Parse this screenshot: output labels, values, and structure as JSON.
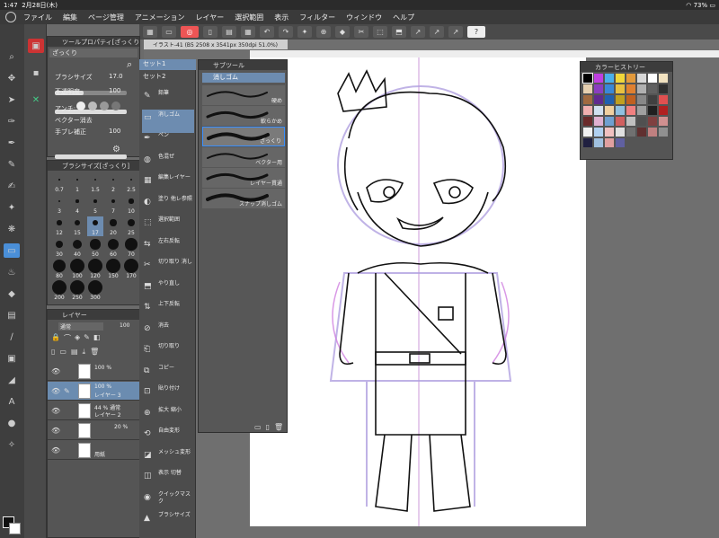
{
  "status": {
    "time": "1:47",
    "date": "2月28日(木)",
    "battery": "73%"
  },
  "menu": [
    "ファイル",
    "編集",
    "ページ管理",
    "アニメーション",
    "レイヤー",
    "選択範囲",
    "表示",
    "フィルター",
    "ウィンドウ",
    "ヘルプ"
  ],
  "canvas": {
    "tab": "イラスト-41 (B5 2508 x 3541px 350dpi 51.0%)"
  },
  "tool_property": {
    "title": "ツールプロパティ[ざっくり]",
    "subtitle": "ざっくり",
    "brush_size_label": "ブラシサイズ",
    "brush_size_value": "17.0",
    "opacity_label": "不透明度",
    "opacity_value": "100",
    "antialias_label": "アンチ:",
    "vector_label": "ベクター消去",
    "stabilize_label": "手ブレ補正",
    "stabilize_value": "100"
  },
  "brush_size_panel": {
    "title": "ブラシサイズ[ざっくり]",
    "sizes": [
      "0.7",
      "1",
      "1.5",
      "2",
      "2.5",
      "3",
      "4",
      "5",
      "7",
      "10",
      "12",
      "15",
      "17",
      "20",
      "25",
      "30",
      "40",
      "50",
      "60",
      "70",
      "80",
      "100",
      "120",
      "150",
      "170",
      "200",
      "250",
      "300"
    ]
  },
  "layer_panel": {
    "title": "レイヤー",
    "blend": "通常",
    "opacity": "100",
    "layers": [
      {
        "name": "",
        "opacity": "100 %"
      },
      {
        "name": "レイヤー 3",
        "opacity": "100 %"
      },
      {
        "name": "レイヤー 2",
        "opacity": "44 % 通常"
      },
      {
        "name": "",
        "opacity": "20 %"
      },
      {
        "name": "用紙",
        "opacity": ""
      }
    ]
  },
  "tool_sets": {
    "set1": "セット1",
    "set2": "セット2"
  },
  "tool_list": [
    {
      "icon": "✎",
      "label": "鉛筆"
    },
    {
      "icon": "▭",
      "label": "消しゴム"
    },
    {
      "icon": "✒",
      "label": "ペン"
    },
    {
      "icon": "◍",
      "label": "色混ぜ"
    },
    {
      "icon": "▦",
      "label": "編集レイヤー"
    },
    {
      "icon": "◐",
      "label": "塗り 他レ参照"
    },
    {
      "icon": "⬚",
      "label": "選択範囲"
    },
    {
      "icon": "⇆",
      "label": "左右反転"
    },
    {
      "icon": "✂",
      "label": "切り取り 消し"
    },
    {
      "icon": "⬒",
      "label": "やり直し"
    },
    {
      "icon": "⇅",
      "label": "上下反転"
    },
    {
      "icon": "⊘",
      "label": "消去"
    },
    {
      "icon": "⎗",
      "label": "切り取り"
    },
    {
      "icon": "⧉",
      "label": "コピー"
    },
    {
      "icon": "⊡",
      "label": "貼り付け"
    },
    {
      "icon": "⊕",
      "label": "拡大 縮小"
    },
    {
      "icon": "⟲",
      "label": "自由変形"
    },
    {
      "icon": "◪",
      "label": "メッシュ変形"
    },
    {
      "icon": "◫",
      "label": "表示 切替"
    },
    {
      "icon": "◉",
      "label": "クイックマスク"
    },
    {
      "icon": "▲",
      "label": "ブラシサイズ"
    }
  ],
  "subtool_panel": {
    "title": "サブツール",
    "group": "消しゴム",
    "items": [
      "硬め",
      "軟らかめ",
      "ざっくり",
      "ベクター用",
      "レイヤー貫通",
      "スナップ消しゴム"
    ],
    "selected": "ざっくり"
  },
  "color_history": {
    "title": "カラーヒストリー",
    "colors": [
      "#000000",
      "#c03fe0",
      "#4ab0ea",
      "#f0d63a",
      "#e39a3c",
      "#d8d8d8",
      "#ffffff",
      "#f2e2c0",
      "#e6d0b0",
      "#8a3ec0",
      "#3a88d8",
      "#e8c040",
      "#e08030",
      "#b0b0b0",
      "#606060",
      "#303030",
      "#a06a40",
      "#602a90",
      "#2060b0",
      "#c0a020",
      "#c06020",
      "#888888",
      "#404040",
      "#e05050",
      "#f0b0b0",
      "#d0e0f0",
      "#f0d0a0",
      "#90c0e0",
      "#f08080",
      "#a0a0a0",
      "#202020",
      "#b02020",
      "#6a2a2a",
      "#e0b0d0",
      "#70a0d0",
      "#d06060",
      "#c0c0c0",
      "#505050",
      "#804040",
      "#d09090",
      "#f0f0f0",
      "#b0d0f0",
      "#f0c0c0",
      "#e0e0e0",
      "#707070",
      "#603030",
      "#c08080",
      "#909090",
      "#202040",
      "#a0c0e0",
      "#e0a0a0",
      "#6060a0"
    ]
  },
  "icons": {
    "toolbar": [
      "zoom-icon",
      "move-icon",
      "operation-icon",
      "eyedropper-icon",
      "pen-icon",
      "pencil-icon",
      "brush-icon",
      "airbrush-icon",
      "decoration-icon",
      "eraser-icon",
      "blend-icon",
      "fill-icon",
      "gradient-icon",
      "figure-icon",
      "frame-icon",
      "ruler-icon",
      "text-icon",
      "balloon-icon",
      "correction-icon"
    ]
  }
}
